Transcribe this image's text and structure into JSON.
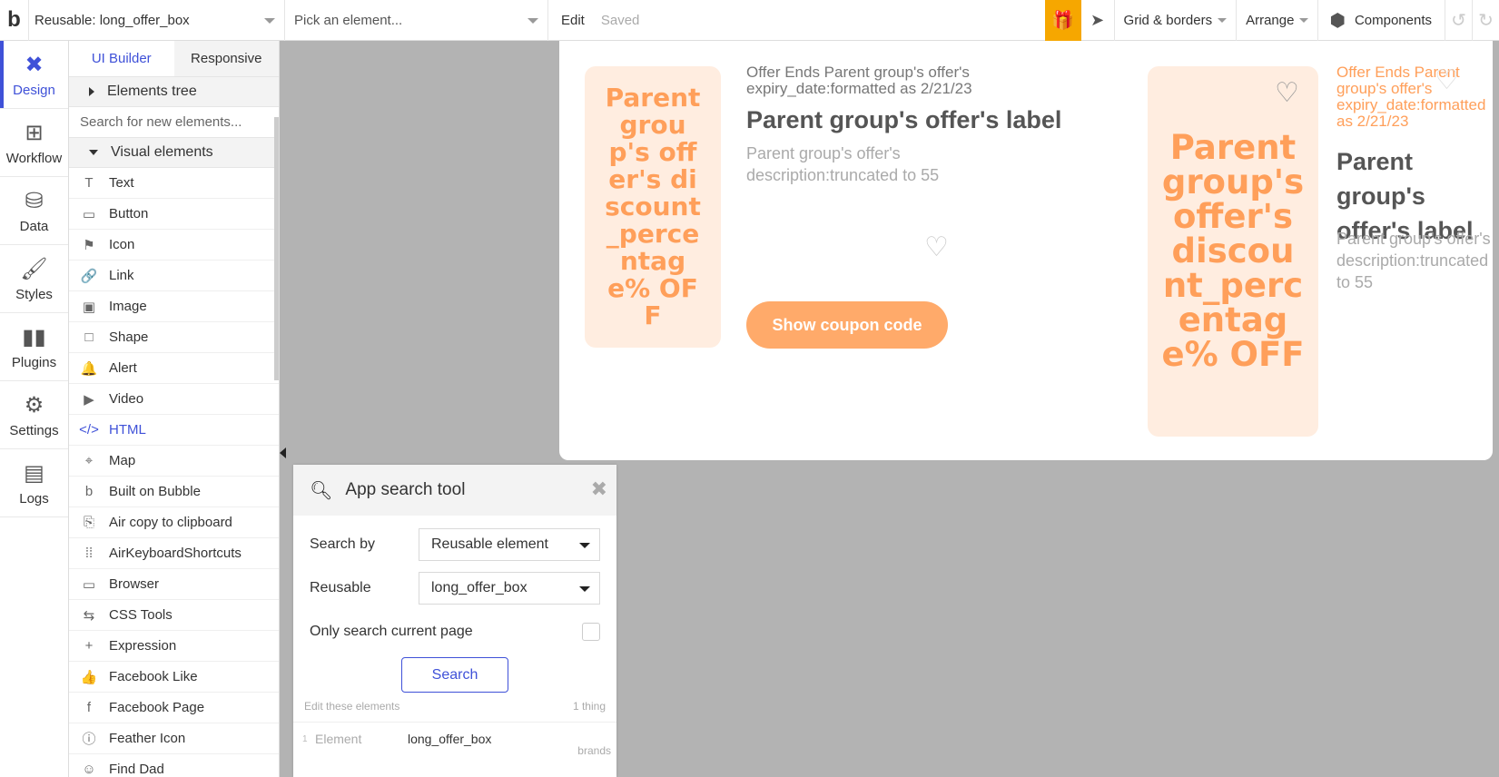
{
  "topbar": {
    "logo": "b",
    "reusable": "Reusable: long_offer_box",
    "pick_placeholder": "Pick an element...",
    "edit": "Edit",
    "saved": "Saved",
    "grid_borders": "Grid & borders",
    "arrange": "Arrange",
    "components": "Components"
  },
  "nav": [
    {
      "label": "Design",
      "icon": "design-icon"
    },
    {
      "label": "Workflow",
      "icon": "workflow-icon"
    },
    {
      "label": "Data",
      "icon": "database-icon"
    },
    {
      "label": "Styles",
      "icon": "brush-icon"
    },
    {
      "label": "Plugins",
      "icon": "plugins-icon"
    },
    {
      "label": "Settings",
      "icon": "gear-icon"
    },
    {
      "label": "Logs",
      "icon": "document-icon"
    }
  ],
  "panel": {
    "tab_ui_builder": "UI Builder",
    "tab_responsive": "Responsive",
    "elements_tree": "Elements tree",
    "search_placeholder": "Search for new elements...",
    "visual_elements": "Visual elements",
    "elements": [
      {
        "label": "Text",
        "glyph": "T"
      },
      {
        "label": "Button",
        "glyph": "▭"
      },
      {
        "label": "Icon",
        "glyph": "⚑"
      },
      {
        "label": "Link",
        "glyph": "🔗"
      },
      {
        "label": "Image",
        "glyph": "▣"
      },
      {
        "label": "Shape",
        "glyph": "□"
      },
      {
        "label": "Alert",
        "glyph": "🔔"
      },
      {
        "label": "Video",
        "glyph": "▶"
      },
      {
        "label": "HTML",
        "glyph": "</>"
      },
      {
        "label": "Map",
        "glyph": "⌖"
      },
      {
        "label": "Built on Bubble",
        "glyph": "b"
      },
      {
        "label": "Air copy to clipboard",
        "glyph": "⎘"
      },
      {
        "label": "AirKeyboardShortcuts",
        "glyph": "⁞⁞"
      },
      {
        "label": "Browser",
        "glyph": "▭"
      },
      {
        "label": "CSS Tools",
        "glyph": "⇆"
      },
      {
        "label": "Expression",
        "glyph": "+"
      },
      {
        "label": "Facebook Like",
        "glyph": "👍"
      },
      {
        "label": "Facebook Page",
        "glyph": "f"
      },
      {
        "label": "Feather Icon",
        "glyph": "ⓘ"
      },
      {
        "label": "Find Dad",
        "glyph": "☺"
      }
    ]
  },
  "offer": {
    "discount_1": "Parent group's offer's discount_percentage% OFF",
    "expiry_1": "Offer Ends Parent group's offer's expiry_date:formatted as 2/21/23",
    "label_1": "Parent group's offer's label",
    "description_1": "Parent group's offer's description:truncated to 55",
    "coupon_button": "Show coupon code",
    "discount_2": "Parent group's offer's discount_percentage% OFF",
    "expiry_2": "Offer Ends Parent group's offer's expiry_date:formatted as 2/21/23",
    "label_2": "Parent group's offer's label",
    "description_2": "Parent group's offer's description:truncated to 55",
    "accent_color": "#ff9f5a"
  },
  "search_tool": {
    "title": "App search tool",
    "search_by_label": "Search by",
    "search_by_value": "Reusable element",
    "reusable_label": "Reusable",
    "reusable_value": "long_offer_box",
    "only_current_page": "Only search current page",
    "search_button": "Search",
    "edit_these": "Edit these elements",
    "count": "1 thing",
    "result_index": "1",
    "result_type": "Element",
    "result_name": "long_offer_box",
    "result_page": "brands"
  }
}
